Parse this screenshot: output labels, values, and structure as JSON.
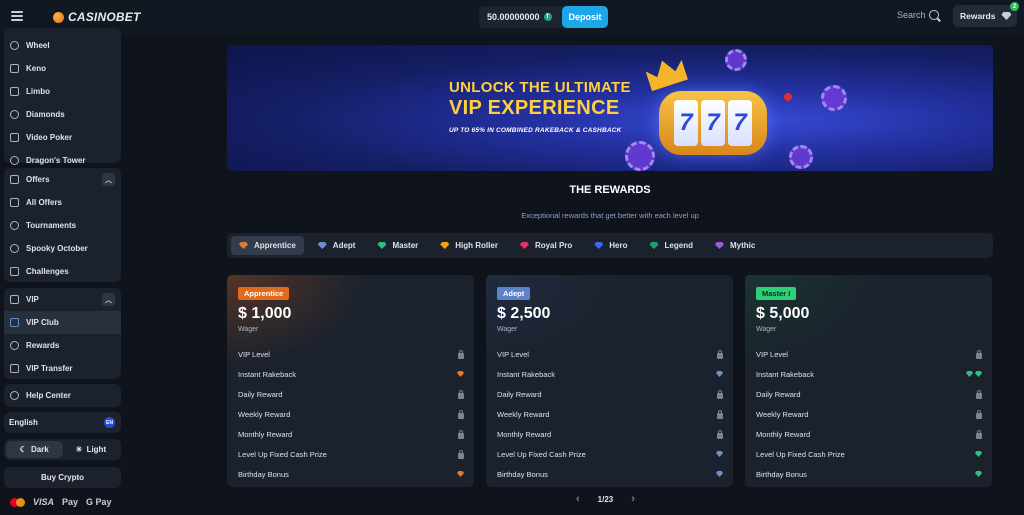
{
  "brand": {
    "name": "CASINOBET"
  },
  "header": {
    "balance": "50.00000000",
    "currency_symbol": "T",
    "deposit_label": "Deposit",
    "search_label": "Search",
    "rewards_label": "Rewards",
    "rewards_count": "2"
  },
  "sidebar": {
    "games": [
      "Wheel",
      "Keno",
      "Limbo",
      "Diamonds",
      "Video Poker",
      "Dragon's Tower"
    ],
    "offers_header": "Offers",
    "offers": [
      "All Offers",
      "Tournaments",
      "Spooky October",
      "Challenges"
    ],
    "vip_header": "VIP",
    "vip": [
      "VIP Club",
      "Rewards",
      "VIP Transfer"
    ],
    "help": "Help Center",
    "language": "English",
    "language_code": "EN",
    "theme_dark": "Dark",
    "theme_light": "Light",
    "buy_crypto": "Buy Crypto",
    "payments": [
      "VISA",
      "Pay",
      "G Pay"
    ]
  },
  "banner": {
    "line1": "UNLOCK THE ULTIMATE",
    "line2": "VIP EXPERIENCE",
    "subtitle": "UP TO 65% IN COMBINED RAKEBACK & CASHBACK",
    "reels": [
      "7",
      "7",
      "7"
    ]
  },
  "rewards": {
    "title": "THE REWARDS",
    "subtitle": "Exceptional rewards that get better with each level up",
    "tabs": [
      {
        "label": "Apprentice",
        "color": "#e07a2c"
      },
      {
        "label": "Adept",
        "color": "#6a8fd6"
      },
      {
        "label": "Master",
        "color": "#2fbf7f"
      },
      {
        "label": "High Roller",
        "color": "#f0a21a"
      },
      {
        "label": "Royal Pro",
        "color": "#e0336a"
      },
      {
        "label": "Hero",
        "color": "#3a6be8"
      },
      {
        "label": "Legend",
        "color": "#1fa067"
      },
      {
        "label": "Mythic",
        "color": "#9a5be8"
      }
    ],
    "cards": [
      {
        "badge": "Apprentice",
        "badge_bg": "#e06a1e",
        "badge_fg": "#ffffff",
        "glow": "#c2561a",
        "amount": "$ 1,000",
        "wager": "Wager",
        "rows": [
          {
            "label": "VIP Level",
            "icon": "lock-icon"
          },
          {
            "label": "Instant Rakeback",
            "icon": "gem-icon",
            "color": "#e07a2c"
          },
          {
            "label": "Daily Reward",
            "icon": "lock-icon"
          },
          {
            "label": "Weekly Reward",
            "icon": "lock-icon"
          },
          {
            "label": "Monthly Reward",
            "icon": "lock-icon"
          },
          {
            "label": "Level Up Fixed Cash Prize",
            "icon": "lock-icon"
          },
          {
            "label": "Birthday Bonus",
            "icon": "gem-icon",
            "color": "#e07a2c"
          }
        ]
      },
      {
        "badge": "Adept",
        "badge_bg": "#5b83c9",
        "badge_fg": "#ffffff",
        "glow": "#2a3d66",
        "amount": "$ 2,500",
        "wager": "Wager",
        "rows": [
          {
            "label": "VIP Level",
            "icon": "lock-icon"
          },
          {
            "label": "Instant Rakeback",
            "icon": "gem-icon",
            "color": "#6a8fd6"
          },
          {
            "label": "Daily Reward",
            "icon": "lock-icon"
          },
          {
            "label": "Weekly Reward",
            "icon": "lock-icon"
          },
          {
            "label": "Monthly Reward",
            "icon": "lock-icon"
          },
          {
            "label": "Level Up Fixed Cash Prize",
            "icon": "gem-icon",
            "color": "#6a8fd6"
          },
          {
            "label": "Birthday Bonus",
            "icon": "gem-icon",
            "color": "#6a8fd6"
          }
        ]
      },
      {
        "badge": "Master I",
        "badge_bg": "#2fcf7a",
        "badge_fg": "#0f2a1a",
        "glow": "#17583a",
        "amount": "$ 5,000",
        "wager": "Wager",
        "rows": [
          {
            "label": "VIP Level",
            "icon": "lock-icon"
          },
          {
            "label": "Instant Rakeback",
            "icon": "gem-icon",
            "color": "#2fbf7f",
            "double": true
          },
          {
            "label": "Daily Reward",
            "icon": "lock-icon"
          },
          {
            "label": "Weekly Reward",
            "icon": "lock-icon"
          },
          {
            "label": "Monthly Reward",
            "icon": "lock-icon"
          },
          {
            "label": "Level Up Fixed Cash Prize",
            "icon": "gem-icon",
            "color": "#2fbf7f"
          },
          {
            "label": "Birthday Bonus",
            "icon": "gem-icon",
            "color": "#2fbf7f"
          }
        ]
      }
    ],
    "pager": "1/23"
  }
}
